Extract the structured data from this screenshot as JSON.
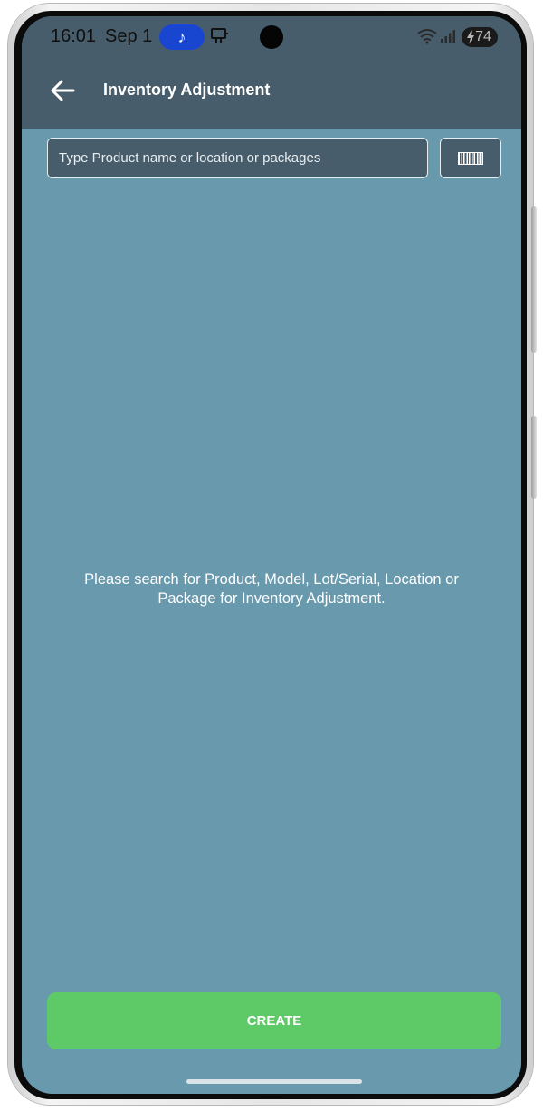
{
  "status_bar": {
    "time": "16:01",
    "date": "Sep 1",
    "battery": "74",
    "music_icon": "music-note-icon"
  },
  "app_bar": {
    "title": "Inventory Adjustment",
    "back_icon": "arrow-left-icon"
  },
  "search": {
    "placeholder": "Type Product name or location or packages",
    "value": "",
    "scan_icon": "barcode-icon"
  },
  "empty_state": {
    "message": "Please search for Product, Model, Lot/Serial, Location or Package for Inventory Adjustment."
  },
  "actions": {
    "create_label": "CREATE"
  },
  "colors": {
    "header": "#485d6b",
    "background": "#6899ad",
    "accent": "#5ec967",
    "music_pill": "#1846d0"
  }
}
